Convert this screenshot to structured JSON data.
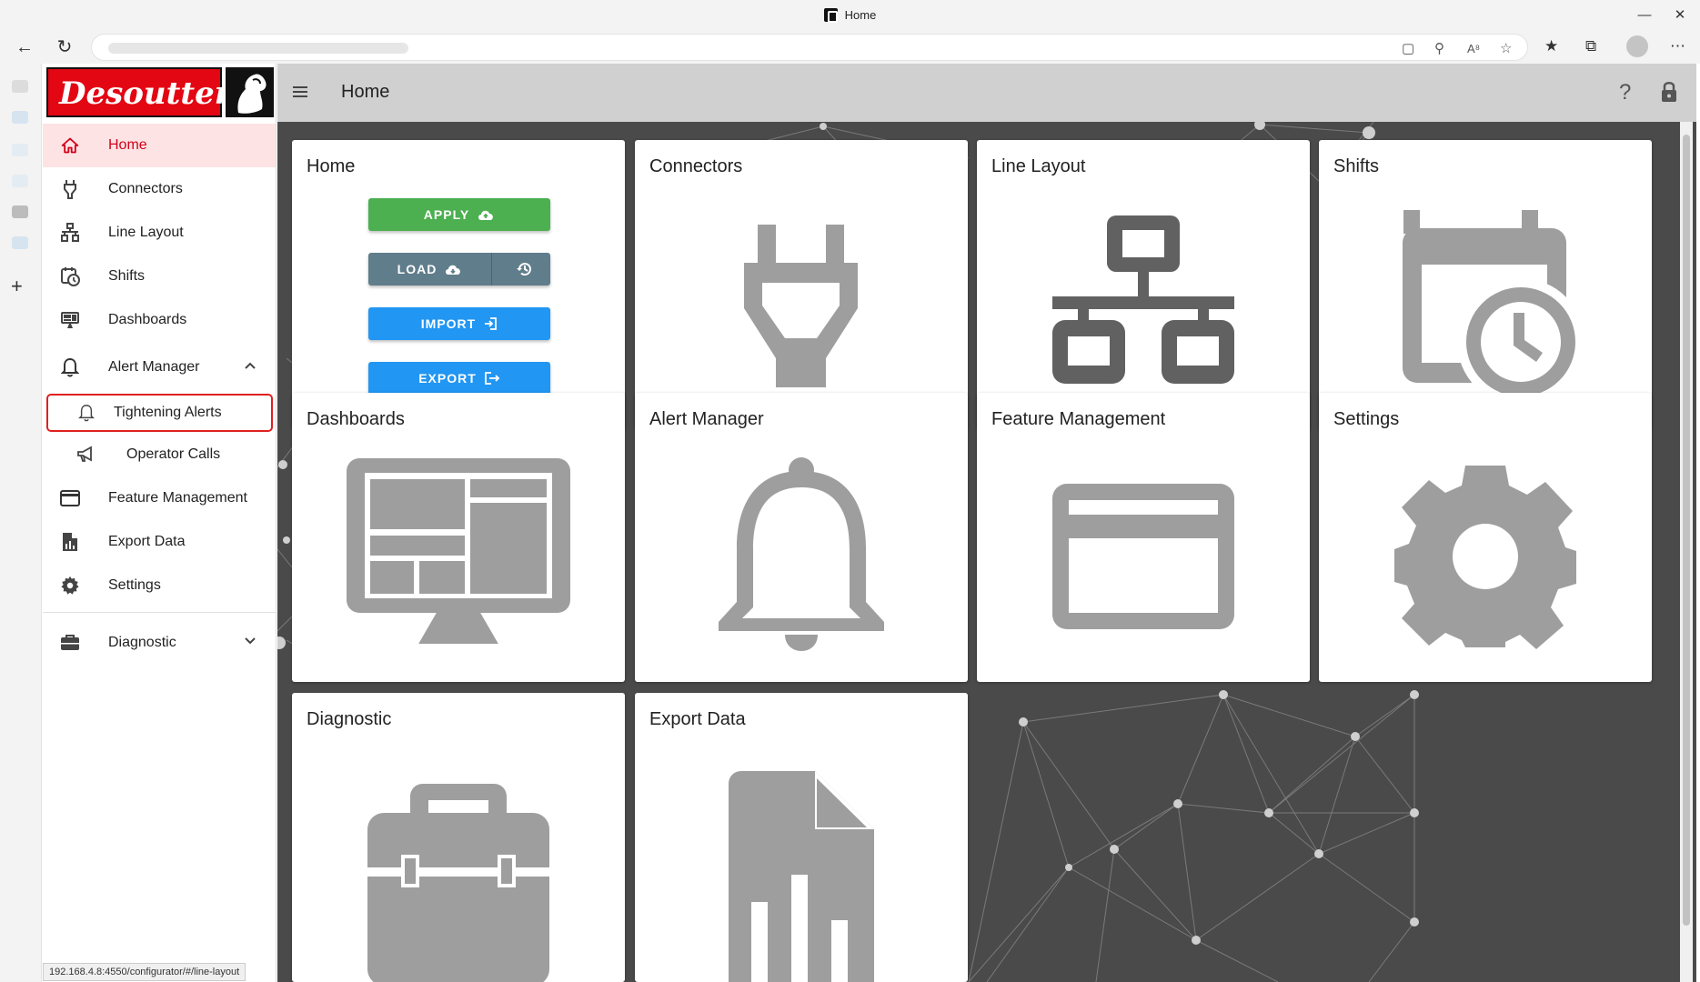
{
  "browser": {
    "tab_title": "Home",
    "status_url": "192.168.4.8:4550/configurator/#/line-layout"
  },
  "sidebar": {
    "logo_text": "Desoutter",
    "items": [
      {
        "label": "Home"
      },
      {
        "label": "Connectors"
      },
      {
        "label": "Line Layout"
      },
      {
        "label": "Shifts"
      },
      {
        "label": "Dashboards"
      },
      {
        "label": "Alert Manager"
      },
      {
        "label": "Tightening Alerts"
      },
      {
        "label": "Operator Calls"
      },
      {
        "label": "Feature Management"
      },
      {
        "label": "Export Data"
      },
      {
        "label": "Settings"
      },
      {
        "label": "Diagnostic"
      }
    ]
  },
  "header": {
    "title": "Home",
    "help": "?"
  },
  "cards": {
    "home": {
      "title": "Home",
      "apply": "APPLY",
      "load": "LOAD",
      "import": "IMPORT",
      "export": "EXPORT"
    },
    "connectors": {
      "title": "Connectors"
    },
    "line_layout": {
      "title": "Line Layout"
    },
    "shifts": {
      "title": "Shifts"
    },
    "dashboards": {
      "title": "Dashboards"
    },
    "alert_manager": {
      "title": "Alert Manager"
    },
    "feature_management": {
      "title": "Feature Management"
    },
    "settings": {
      "title": "Settings"
    },
    "diagnostic": {
      "title": "Diagnostic"
    },
    "export_data": {
      "title": "Export Data"
    }
  },
  "colors": {
    "accent_red": "#e30613",
    "apply_green": "#4caf50",
    "action_blue": "#2196f3",
    "load_grey": "#607d8b",
    "icon_grey": "#9e9e9e",
    "dark_icon": "#616161"
  }
}
